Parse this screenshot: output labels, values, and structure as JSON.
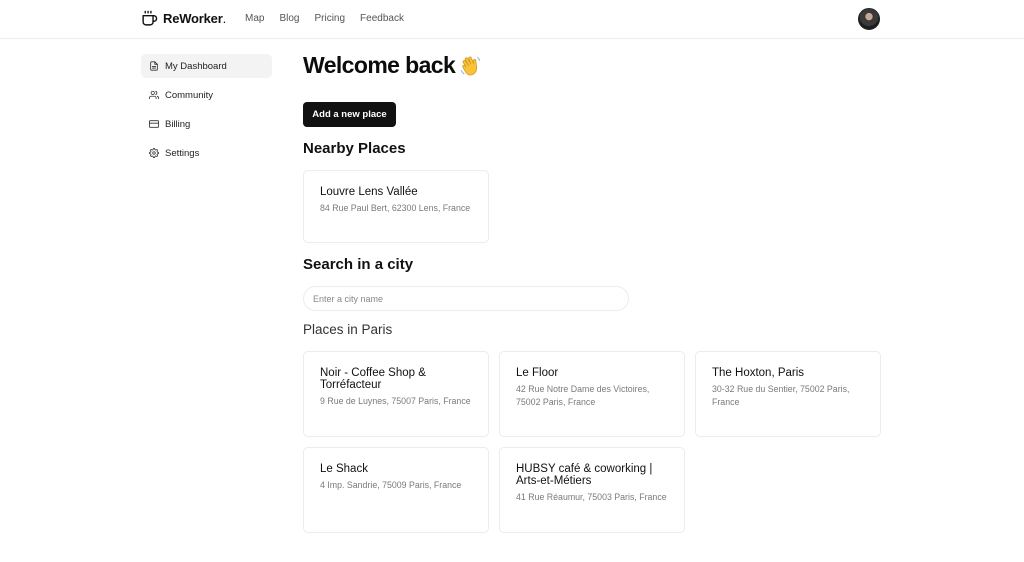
{
  "header": {
    "brand": "ReWorker",
    "brand_dot": ".",
    "nav": [
      "Map",
      "Blog",
      "Pricing",
      "Feedback"
    ]
  },
  "sidebar": {
    "items": [
      {
        "label": "My Dashboard",
        "icon": "document-icon",
        "active": true
      },
      {
        "label": "Community",
        "icon": "users-icon"
      },
      {
        "label": "Billing",
        "icon": "credit-card-icon"
      },
      {
        "label": "Settings",
        "icon": "gear-icon"
      }
    ]
  },
  "main": {
    "welcome": "Welcome back",
    "welcome_emoji": "waving-hand-icon",
    "add_button": "Add a new place",
    "nearby_heading": "Nearby Places",
    "nearby": [
      {
        "name": "Louvre Lens Vallée",
        "address": "84 Rue Paul Bert, 62300 Lens, France"
      }
    ],
    "search_heading": "Search in a city",
    "search_placeholder": "Enter a city name",
    "city_heading": "Places in Paris",
    "places": [
      {
        "name": "Noir - Coffee Shop & Torréfacteur",
        "address": "9 Rue de Luynes, 75007 Paris, France"
      },
      {
        "name": "Le Floor",
        "address": "42 Rue Notre Dame des Victoires, 75002 Paris, France"
      },
      {
        "name": "The Hoxton, Paris",
        "address": "30-32 Rue du Sentier, 75002 Paris, France"
      },
      {
        "name": "Le Shack",
        "address": "4 Imp. Sandrie, 75009 Paris, France"
      },
      {
        "name": "HUBSY café & coworking | Arts-et-Métiers",
        "address": "41 Rue Réaumur, 75003 Paris, France"
      }
    ]
  }
}
